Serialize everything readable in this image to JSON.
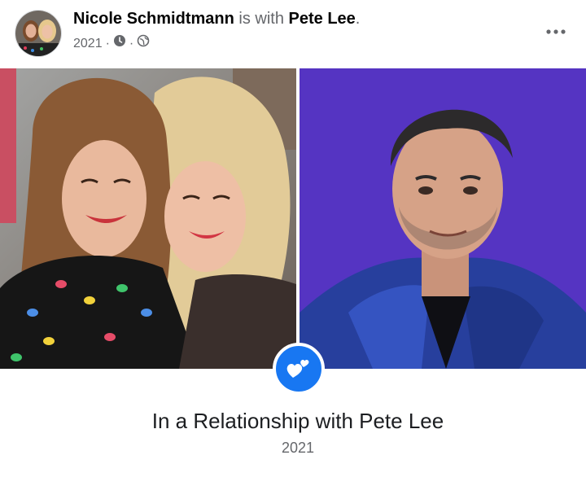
{
  "post": {
    "author": "Nicole Schmidtmann",
    "with_text": "is with",
    "tagged": "Pete Lee",
    "period": ".",
    "year": "2021",
    "separator": "·"
  },
  "icons": {
    "time": "clock-icon",
    "audience": "globe-icon",
    "menu": "more-options-icon",
    "event": "hearts-icon"
  },
  "life_event": {
    "title": "In a Relationship with Pete Lee",
    "year": "2021"
  },
  "colors": {
    "accent": "#1877f2",
    "secondary_text": "#65676b",
    "right_photo_background": "#5534c2"
  }
}
